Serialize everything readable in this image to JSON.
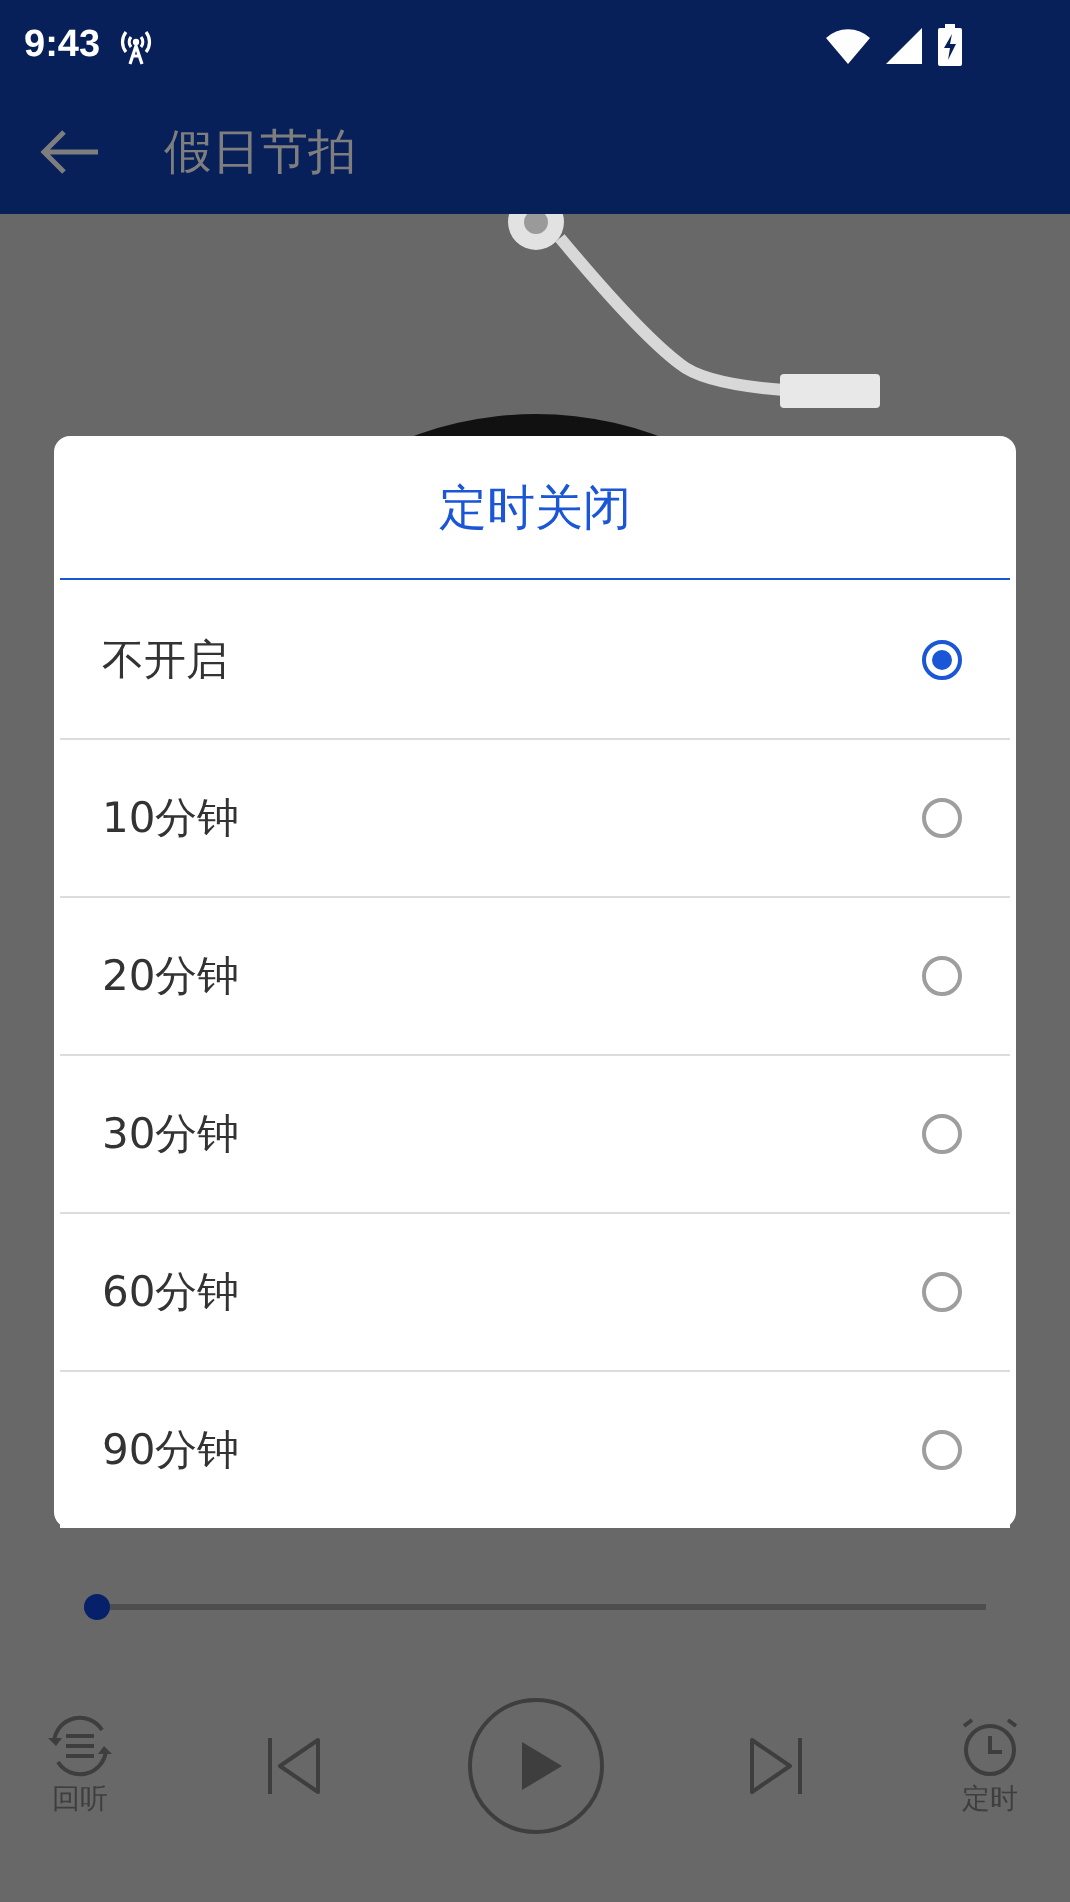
{
  "status_bar": {
    "time": "9:43"
  },
  "app_bar": {
    "title": "假日节拍"
  },
  "player": {
    "progress": {
      "level": 0
    },
    "controls": [
      {
        "kind": "replay",
        "label": "回听"
      },
      {
        "kind": "previous"
      },
      {
        "kind": "play"
      },
      {
        "kind": "next"
      },
      {
        "kind": "timer",
        "label": "定时"
      }
    ]
  },
  "dialog": {
    "title": "定时关闭",
    "options": [
      {
        "label": "不开启",
        "selected": true
      },
      {
        "label": "10分钟",
        "selected": false
      },
      {
        "label": "20分钟",
        "selected": false
      },
      {
        "label": "30分钟",
        "selected": false
      },
      {
        "label": "60分钟",
        "selected": false
      },
      {
        "label": "90分钟",
        "selected": false
      }
    ]
  }
}
